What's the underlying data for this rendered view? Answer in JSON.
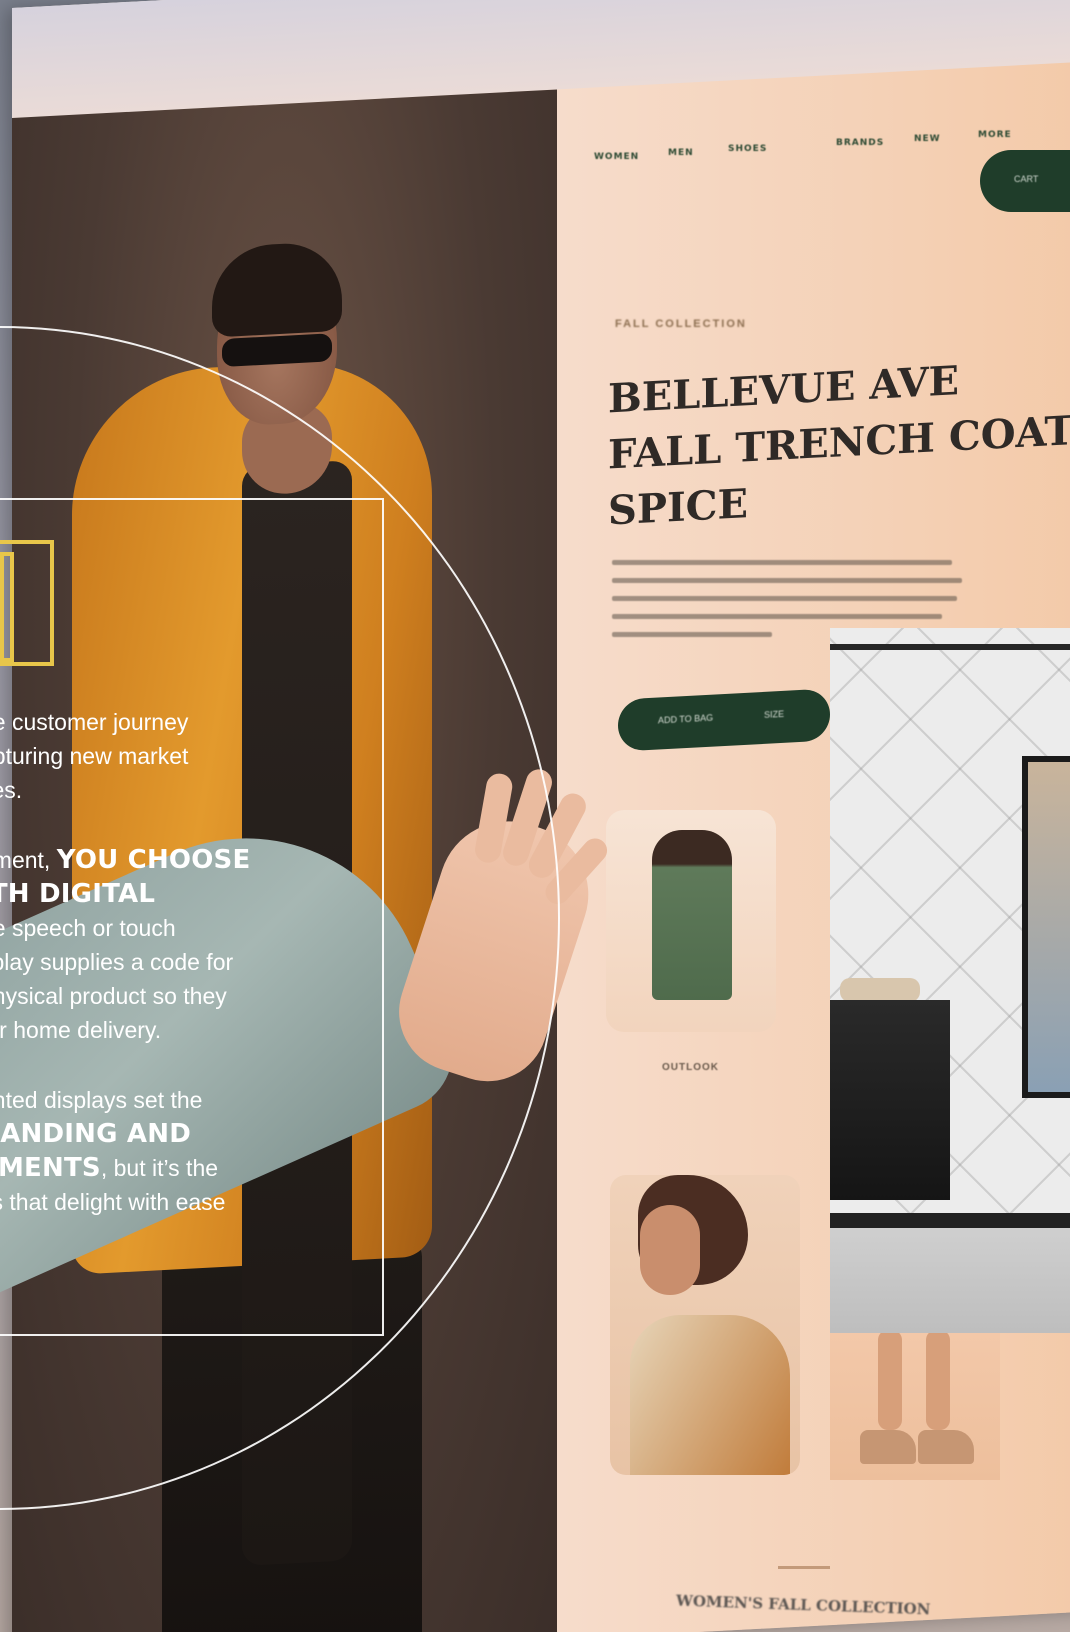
{
  "nav": {
    "items": [
      "WOMEN",
      "MEN",
      "SHOES",
      "BRANDS",
      "NEW",
      "MORE"
    ],
    "cta_label": "CART"
  },
  "product": {
    "eyebrow": "FALL COLLECTION",
    "title_lines": [
      "BELLEVUE AVE",
      "FALL TRENCH COAT",
      "SPICE"
    ],
    "button_left": "ADD TO BAG",
    "button_right": "SIZE"
  },
  "cards": {
    "first_caption": "OUTLOOK"
  },
  "footer": {
    "text": "WOMEN'S FALL COLLECTION"
  },
  "overlay": {
    "para1": [
      "ne customer journey",
      "apturing new market",
      "ces."
    ],
    "para2_pre": "nment, ",
    "para2_bold1": "YOU CHOOSE",
    "para2_bold2": "ITH DIGITAL",
    "para2_rest": [
      "de speech or touch",
      "splay supplies a code for",
      "physical product so they",
      " for home delivery."
    ],
    "para3_line1": "unted displays set the",
    "para3_bold1": "RANDING AND",
    "para3_bold2": "EMENTS",
    "para3_after_bold2": ", but it’s the",
    "para3_line4": "ys that delight with ease"
  },
  "colors": {
    "accent_green": "#1f3d2a",
    "overlay_yellow": "#e8c64a",
    "overlay_white": "#ffffff"
  }
}
